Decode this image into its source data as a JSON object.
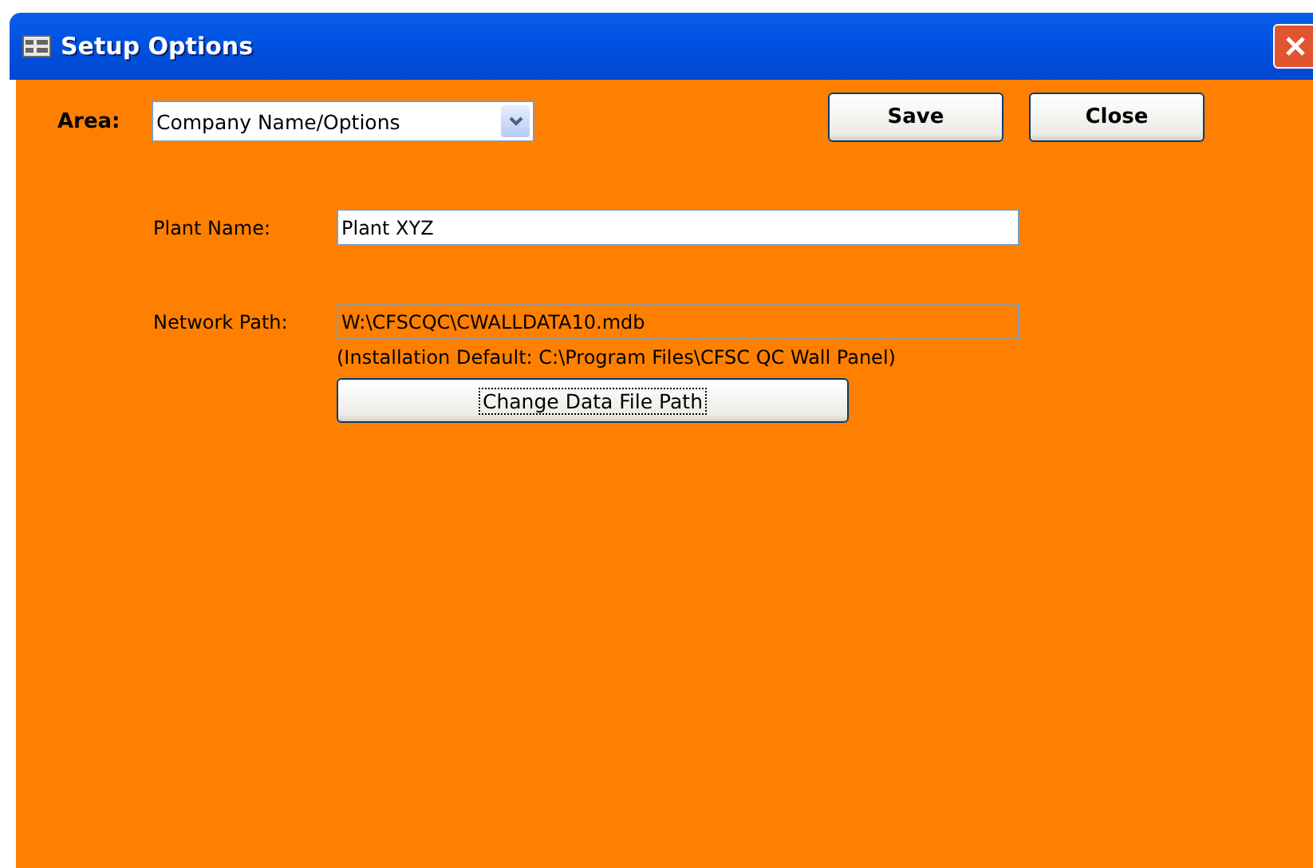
{
  "window": {
    "title": "Setup Options"
  },
  "area": {
    "label": "Area:",
    "value": "Company Name/Options"
  },
  "buttons": [
    {
      "label": "Save"
    },
    {
      "label": "Close"
    }
  ],
  "fields": [
    {
      "label": "Plant Name:",
      "value": "Plant XYZ",
      "disabled": false
    },
    {
      "label": "Network Path:",
      "value": "W:\\CFSCQC\\CWALLDATA10.mdb",
      "disabled": true
    }
  ],
  "default_note": "(Installation Default: C:\\Program Files\\CFSC QC Wall Panel)",
  "change_button": {
    "label": "Change Data File Path",
    "focused": true
  }
}
